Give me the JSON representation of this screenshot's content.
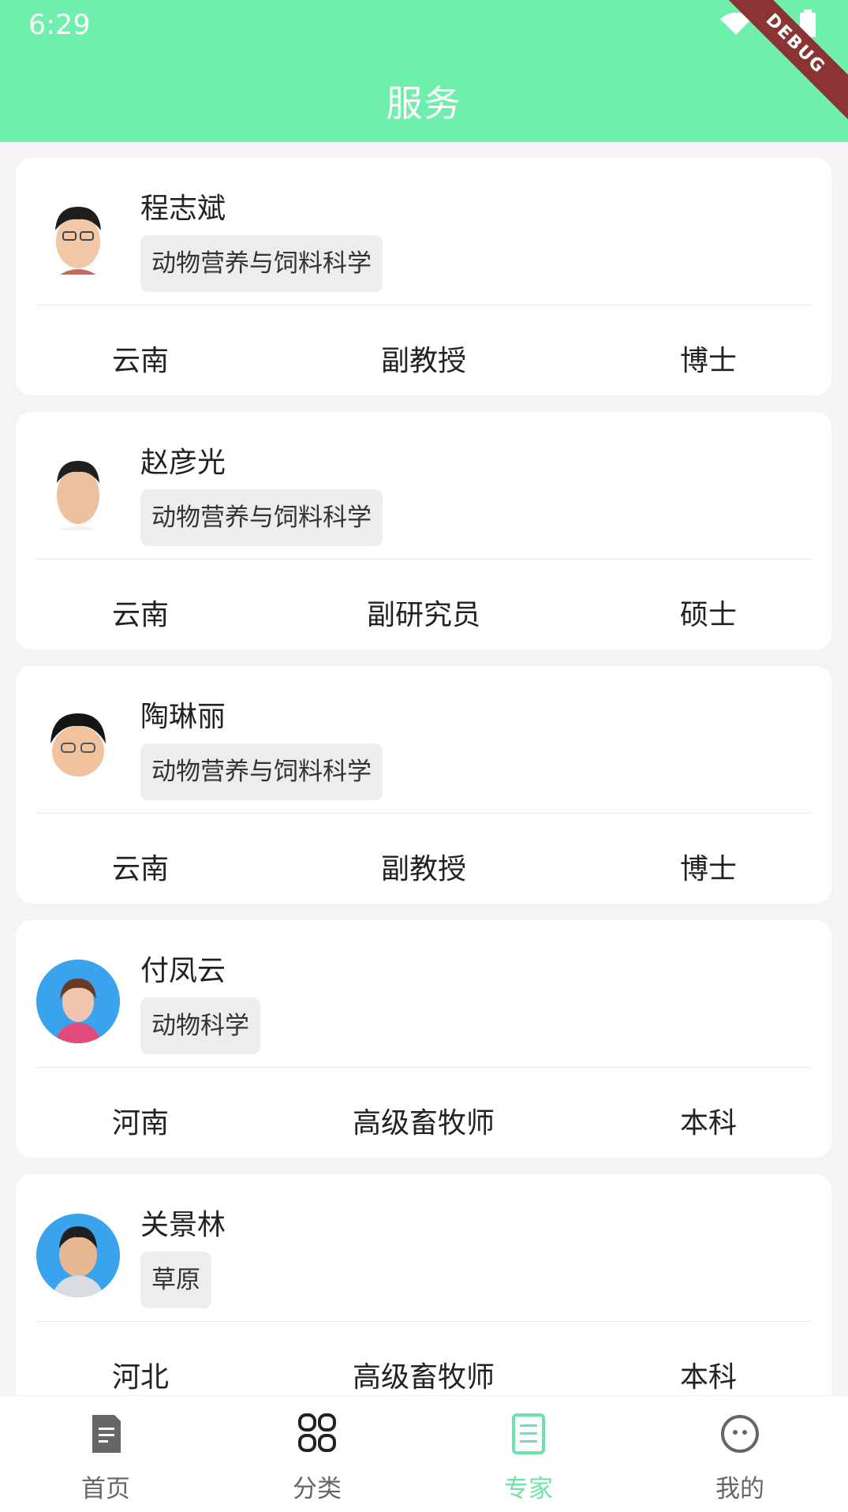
{
  "status_bar": {
    "time": "6:29",
    "debug_label": "DEBUG"
  },
  "header": {
    "title": "服务"
  },
  "experts": [
    {
      "name": "程志斌",
      "tag": "动物营养与饲料科学",
      "region": "云南",
      "title": "副教授",
      "degree": "博士",
      "avatar_style": "plain"
    },
    {
      "name": "赵彦光",
      "tag": "动物营养与饲料科学",
      "region": "云南",
      "title": "副研究员",
      "degree": "硕士",
      "avatar_style": "plain"
    },
    {
      "name": "陶琳丽",
      "tag": "动物营养与饲料科学",
      "region": "云南",
      "title": "副教授",
      "degree": "博士",
      "avatar_style": "plain"
    },
    {
      "name": "付凤云",
      "tag": "动物科学",
      "region": "河南",
      "title": "高级畜牧师",
      "degree": "本科",
      "avatar_style": "blue"
    },
    {
      "name": "关景林",
      "tag": "草原",
      "region": "河北",
      "title": "高级畜牧师",
      "degree": "本科",
      "avatar_style": "blue"
    }
  ],
  "bottom_nav": {
    "items": [
      {
        "label": "首页",
        "icon": "document-icon",
        "active": false
      },
      {
        "label": "分类",
        "icon": "grid-icon",
        "active": false
      },
      {
        "label": "专家",
        "icon": "list-document-icon",
        "active": true
      },
      {
        "label": "我的",
        "icon": "face-icon",
        "active": false
      }
    ]
  },
  "colors": {
    "accent": "#6ef0ac",
    "active_nav": "#6ee3a8"
  }
}
